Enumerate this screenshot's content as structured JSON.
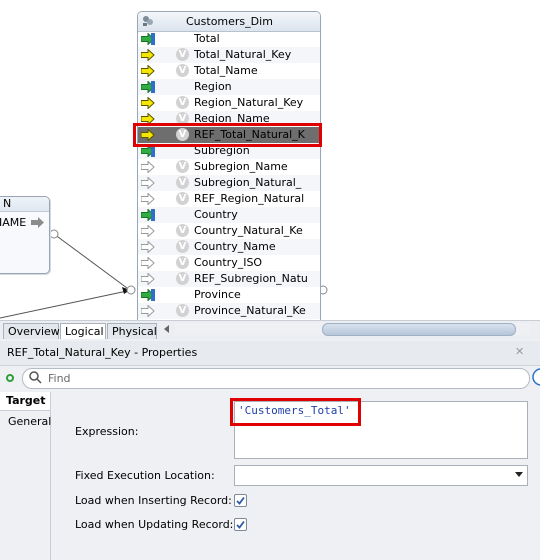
{
  "diagram": {
    "left_box": {
      "title": "N",
      "row_label": "IAME"
    },
    "dim": {
      "title": "Customers_Dim",
      "attributes": [
        {
          "name": "Total",
          "icon": "green-key-arrow",
          "vbadge": false
        },
        {
          "name": "Total_Natural_Key",
          "icon": "yellow-arrow",
          "vbadge": true
        },
        {
          "name": "Total_Name",
          "icon": "yellow-arrow",
          "vbadge": true
        },
        {
          "name": "Region",
          "icon": "green-key-arrow",
          "vbadge": false
        },
        {
          "name": "Region_Natural_Key",
          "icon": "yellow-arrow",
          "vbadge": true
        },
        {
          "name": "Region_Name",
          "icon": "yellow-arrow",
          "vbadge": true
        },
        {
          "name": "REF_Total_Natural_K",
          "icon": "yellow-arrow",
          "vbadge": true,
          "selected": true
        },
        {
          "name": "Subregion",
          "icon": "green-key-arrow",
          "vbadge": false
        },
        {
          "name": "Subregion_Name",
          "icon": "grey-arrow",
          "vbadge": true
        },
        {
          "name": "Subregion_Natural_",
          "icon": "grey-arrow",
          "vbadge": true
        },
        {
          "name": "REF_Region_Natural",
          "icon": "grey-arrow",
          "vbadge": true
        },
        {
          "name": "Country",
          "icon": "green-key-arrow",
          "vbadge": false
        },
        {
          "name": "Country_Natural_Ke",
          "icon": "grey-arrow",
          "vbadge": true
        },
        {
          "name": "Country_Name",
          "icon": "grey-arrow",
          "vbadge": true
        },
        {
          "name": "Country_ISO",
          "icon": "grey-arrow",
          "vbadge": true
        },
        {
          "name": "REF_Subregion_Natu",
          "icon": "grey-arrow",
          "vbadge": true
        },
        {
          "name": "Province",
          "icon": "green-key-arrow",
          "vbadge": false
        },
        {
          "name": "Province_Natural_Ke",
          "icon": "grey-arrow",
          "vbadge": true
        }
      ]
    }
  },
  "tabs": [
    "Overview",
    "Logical",
    "Physical"
  ],
  "active_tab": "Logical",
  "properties": {
    "title": "REF_Total_Natural_Key - Properties",
    "search_placeholder": "Find",
    "side_tabs": {
      "target": "Target",
      "general": "General"
    },
    "expression_label": "Expression:",
    "expression_value": "'Customers_Total'",
    "fixed_location_label": "Fixed Execution Location:",
    "fixed_location_value": "",
    "load_insert_label": "Load when Inserting Record:",
    "load_insert_checked": true,
    "load_update_label": "Load when Updating Record:",
    "load_update_checked": true
  },
  "colors": {
    "highlight": "#e00000",
    "selected_row": "#6e6e6e",
    "expression_text": "#1f3fa6"
  }
}
